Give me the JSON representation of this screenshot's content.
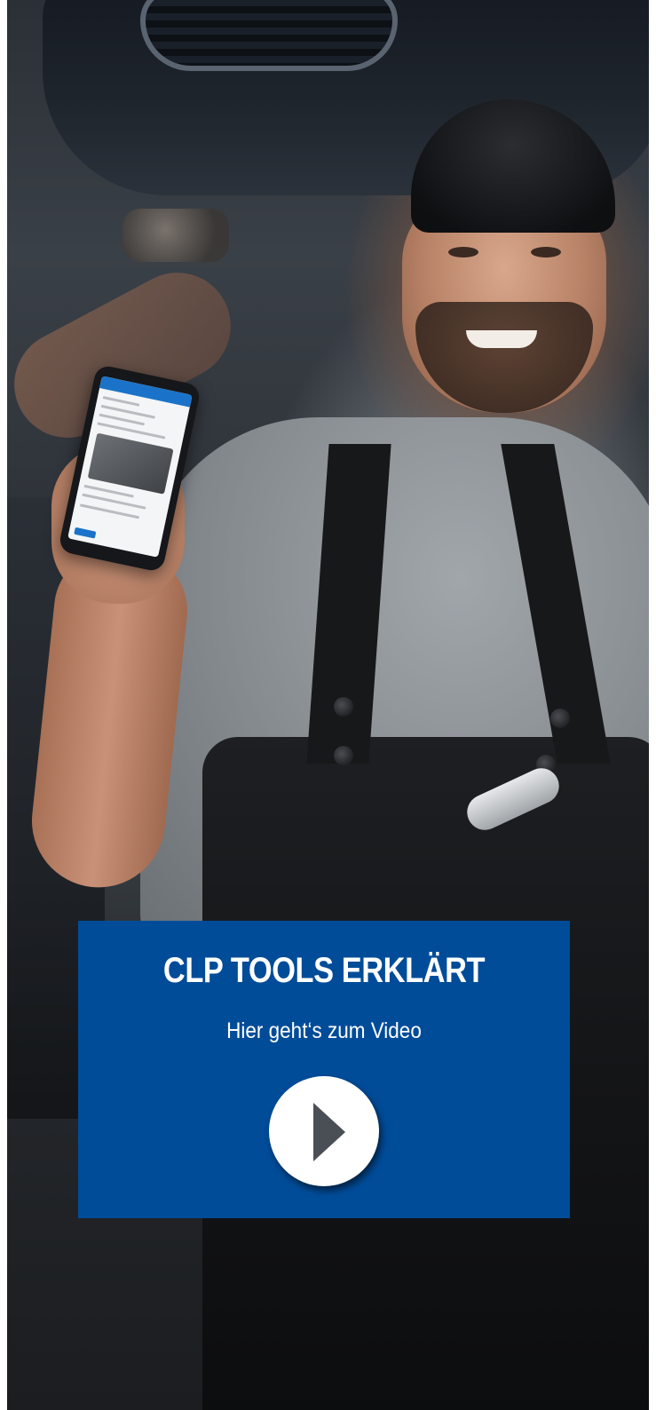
{
  "hero": {
    "image_icon": "mechanic-holding-phone-photo"
  },
  "cta": {
    "title": "CLP TOOLS ERKLÄRT",
    "subtitle": "Hier geht‘s zum Video",
    "play_icon": "play-icon",
    "background_color": "#004c99",
    "text_color": "#ffffff"
  }
}
